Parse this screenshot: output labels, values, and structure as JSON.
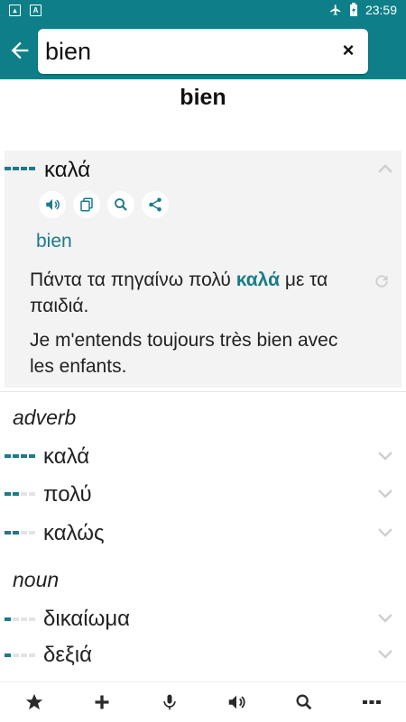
{
  "status_bar": {
    "time": "23:59",
    "brand_color": "#0e7f88"
  },
  "search": {
    "query": "bien"
  },
  "headword": "bien",
  "first_meaning": {
    "word": "καλά",
    "freq_level": 4,
    "translation": "bien",
    "example_greek_before": "Πάντα τα πηγαίνω πολύ ",
    "example_greek_highlight": "καλά",
    "example_greek_after": " με τα παιδιά.",
    "example_french": "Je m'entends toujours très bien avec les enfants.",
    "actions": [
      "speaker-icon",
      "copy-icon",
      "search-icon",
      "share-icon"
    ]
  },
  "sections": [
    {
      "pos": "adverb",
      "items": [
        {
          "word": "καλά",
          "freq": 4
        },
        {
          "word": "πολύ",
          "freq": 2
        },
        {
          "word": "καλώς",
          "freq": 2
        }
      ]
    },
    {
      "pos": "noun",
      "items": [
        {
          "word": "δικαίωμα",
          "freq": 1
        },
        {
          "word": "δεξιά",
          "freq": 1
        }
      ]
    }
  ],
  "bottom_nav": [
    "star-icon",
    "plus-icon",
    "microphone-icon",
    "speaker-icon",
    "search-icon",
    "more-icon"
  ],
  "accent_color": "#1b7b89"
}
